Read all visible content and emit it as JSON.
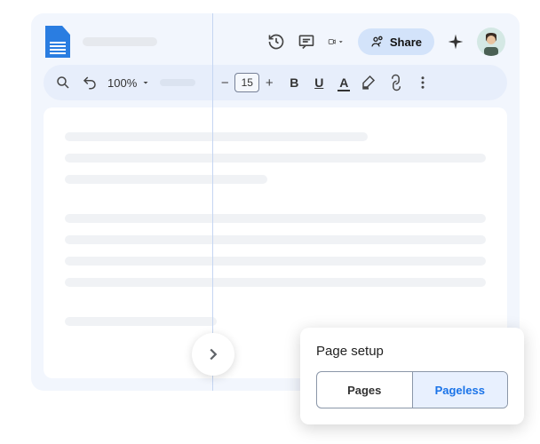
{
  "header": {
    "share_label": "Share"
  },
  "toolbar": {
    "zoom": "100%",
    "font_size": "15"
  },
  "panel": {
    "title": "Page setup",
    "pages_label": "Pages",
    "pageless_label": "Pageless"
  }
}
